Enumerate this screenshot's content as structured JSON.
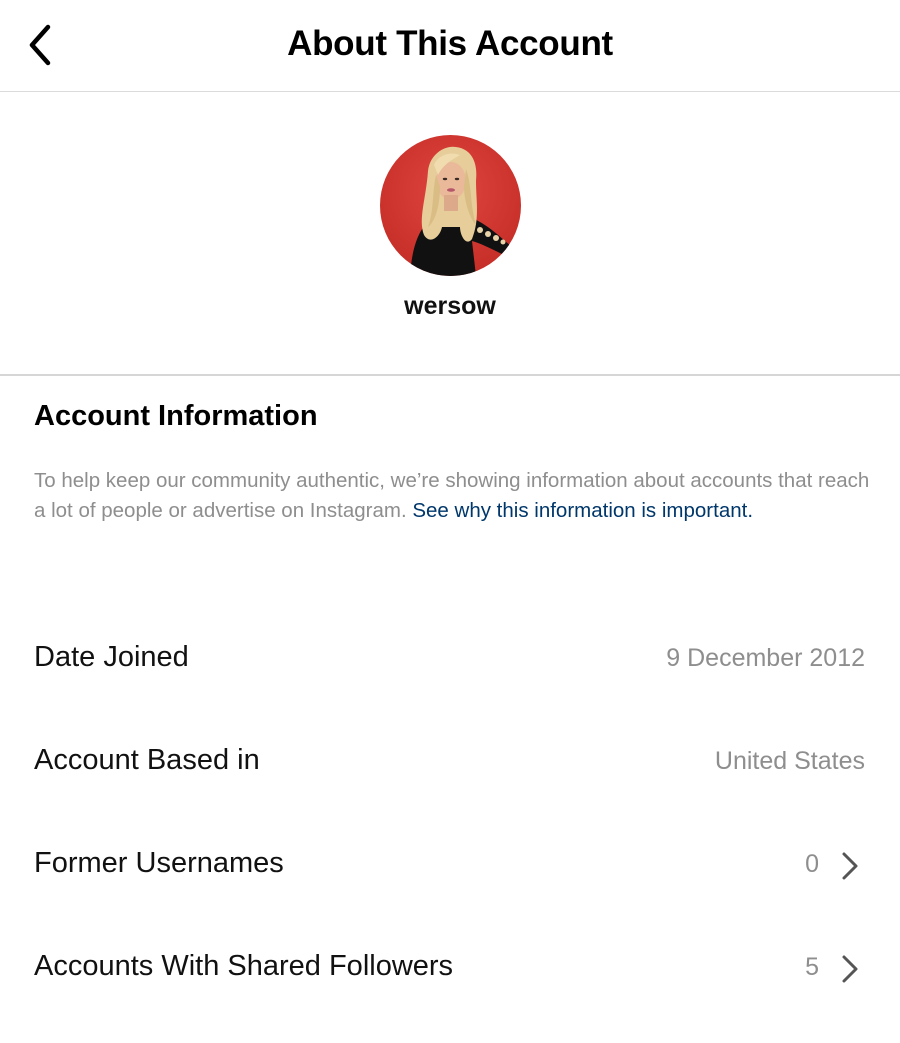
{
  "header": {
    "title": "About This Account",
    "back_icon": "chevron-left-icon"
  },
  "profile": {
    "username": "wersow",
    "avatar_background": "#d63a33"
  },
  "account_info": {
    "title": "Account Information",
    "description": "To help keep our community authentic, we’re showing information about accounts that reach a lot of people or advertise on Instagram. ",
    "link_text": "See why this information is important."
  },
  "rows": [
    {
      "label": "Date Joined",
      "value": "9 December 2012"
    },
    {
      "label": "Account Based in",
      "value": "United States"
    },
    {
      "label": "Former Usernames",
      "value": "0",
      "icon": "chevron-right-icon"
    },
    {
      "label": "Accounts With Shared Followers",
      "value": "5",
      "icon": "chevron-right-icon"
    }
  ],
  "colors": {
    "link": "#00376b",
    "secondary_text": "#8e8e8e",
    "divider": "#dbdbdb"
  }
}
